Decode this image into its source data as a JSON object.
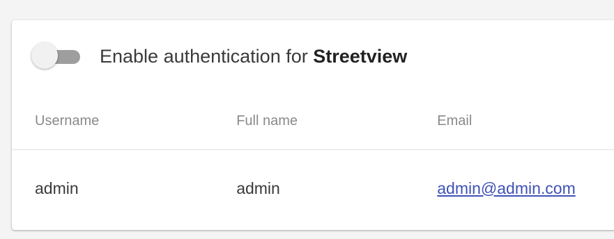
{
  "auth": {
    "toggle_label_prefix": "Enable authentication for",
    "service_name": "Streetview",
    "enabled": false
  },
  "users_table": {
    "columns": [
      "Username",
      "Full name",
      "Email"
    ],
    "rows": [
      {
        "username": "admin",
        "full_name": "admin",
        "email": "admin@admin.com"
      }
    ]
  },
  "colors": {
    "track_off": "#9e9e9e",
    "thumb_off": "#f1f1f1",
    "link": "#3f51b5"
  }
}
